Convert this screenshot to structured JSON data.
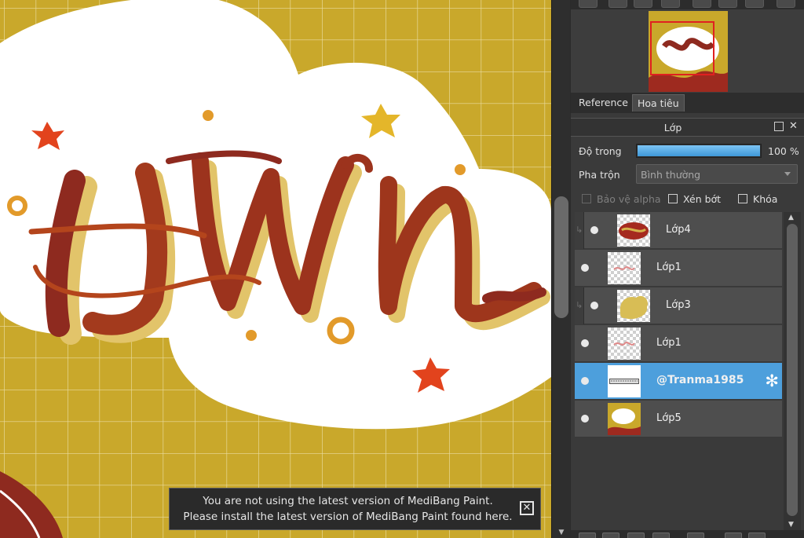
{
  "navigator": {
    "tabs": [
      {
        "label": "Reference"
      },
      {
        "label": "Hoa tiêu"
      }
    ]
  },
  "layer_panel": {
    "title": "Lớp",
    "opacity_label": "Độ trong",
    "opacity_value": "100 %",
    "opacity_fraction": 1.0,
    "blend_label": "Pha trộn",
    "blend_value": "Bình thường",
    "protect_alpha_label": "Bảo vệ alpha",
    "clipping_label": "Xén bớt",
    "lock_label": "Khóa",
    "layers": [
      {
        "name": "Lớp4",
        "clipped": true,
        "selected": false
      },
      {
        "name": "Lớp1",
        "clipped": false,
        "selected": false
      },
      {
        "name": "Lớp3",
        "clipped": true,
        "selected": false
      },
      {
        "name": "Lớp1",
        "clipped": false,
        "selected": false
      },
      {
        "name": "@Tranma1985",
        "clipped": false,
        "selected": true
      },
      {
        "name": "Lớp5",
        "clipped": false,
        "selected": false
      }
    ]
  },
  "notification": {
    "line1": "You are not using the latest version of MediBang Paint.",
    "line2": "Please install the latest version of MediBang Paint found here."
  },
  "colors": {
    "canvas_bg": "#c9a82b",
    "selected_layer": "#4d9fdc",
    "lettering_dark": "#8e2a1f",
    "lettering_mid": "#b4451c",
    "lettering_shadow": "#e2c46a",
    "star_red": "#e2431d",
    "star_yellow": "#e4b62a"
  }
}
